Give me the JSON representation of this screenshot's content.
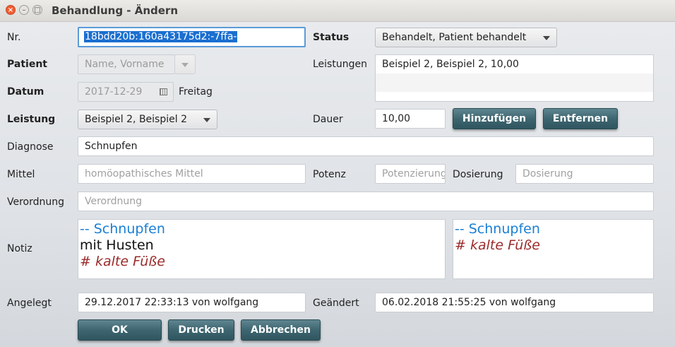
{
  "window": {
    "title": "Behandlung - Ändern",
    "close_icon": "×",
    "minimize_icon": "–",
    "maximize_icon": "□"
  },
  "labels": {
    "nr": "Nr.",
    "patient": "Patient",
    "datum": "Datum",
    "leistung": "Leistung",
    "diagnose": "Diagnose",
    "mittel": "Mittel",
    "verordnung": "Verordnung",
    "notiz": "Notiz",
    "angelegt": "Angelegt",
    "status": "Status",
    "leistungen": "Leistungen",
    "dauer": "Dauer",
    "potenz": "Potenz",
    "dosierung": "Dosierung",
    "geaendert": "Geändert"
  },
  "fields": {
    "nr_value": "18bdd20b:160a43175d2:-7ffa-",
    "patient_placeholder": "Name, Vorname",
    "datum_value": "2017-12-29",
    "weekday": "Freitag",
    "leistung_value": "Beispiel 2, Beispiel 2",
    "status_value": "Behandelt, Patient behandelt",
    "dauer_value": "10,00",
    "diagnose_value": "Schnupfen",
    "mittel_placeholder": "homöopathisches Mittel",
    "potenz_placeholder": "Potenzierung",
    "dosierung_placeholder": "Dosierung",
    "verordnung_placeholder": "Verordnung",
    "angelegt_value": "29.12.2017 22:33:13 von wolfgang",
    "geaendert_value": "06.02.2018 21:55:25 von wolfgang"
  },
  "leistungen_list": [
    "Beispiel 2, Beispiel 2, 10,00"
  ],
  "notiz_left": {
    "line1": "-- Schnupfen",
    "line2": "mit Husten",
    "line3": "# kalte Füße"
  },
  "notiz_right": {
    "line1": "-- Schnupfen",
    "line2": "# kalte Füße"
  },
  "buttons": {
    "hinzufuegen": "Hinzufügen",
    "entfernen": "Entfernen",
    "ok": "OK",
    "drucken": "Drucken",
    "abbrechen": "Abbrechen"
  },
  "icons": {
    "calendar": "calendar-icon",
    "dropdown": "chevron-down-icon"
  },
  "colors": {
    "selection": "#1b6fd0",
    "note_heading": "#1a7fd4",
    "note_comment": "#9b2a2a",
    "dark_button": "#3e6670"
  }
}
